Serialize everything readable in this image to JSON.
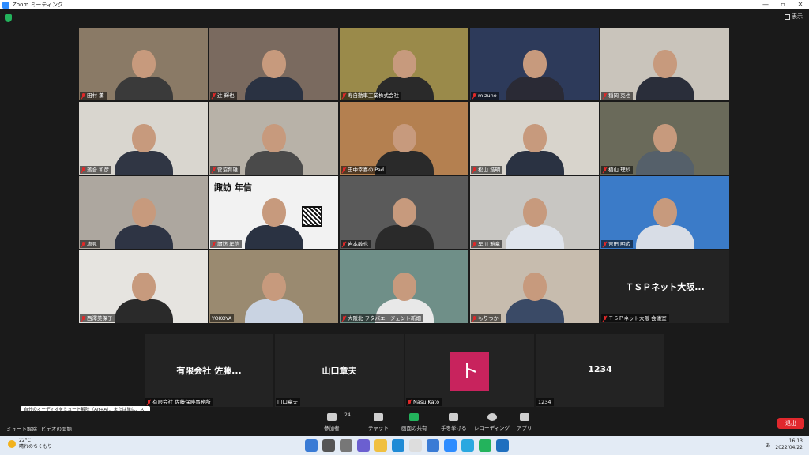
{
  "window": {
    "title": "Zoom ミーティング",
    "controls": [
      "—",
      "▫",
      "✕"
    ]
  },
  "view_label": "表示",
  "tiles": [
    {
      "name": "田村 薫",
      "bg": "#8a7a66",
      "shirt": "#3a3a3a"
    },
    {
      "name": "辻 輝也",
      "bg": "#7a6a5f",
      "shirt": "#2a3242"
    },
    {
      "name": "寿自動車工業株式会社",
      "bg": "#9a8a4a",
      "shirt": "#2a2a2a"
    },
    {
      "name": "mizuno",
      "bg": "#2d3a5a",
      "shirt": "#2a2a35"
    },
    {
      "name": "稲岡 克也",
      "bg": "#c9c4bb",
      "shirt": "#2a2e3a"
    },
    {
      "name": "落合 和彦",
      "bg": "#d9d6cf",
      "shirt": "#303644"
    },
    {
      "name": "菅沼育雄",
      "bg": "#b8b2a8",
      "shirt": "#4a4a4a"
    },
    {
      "name": "田中幸喜のiPad",
      "bg": "#b48050",
      "shirt": "#2a2a2a"
    },
    {
      "name": "松山 浩明",
      "bg": "#d8d4cc",
      "shirt": "#2a3242"
    },
    {
      "name": "橋山 理紗",
      "bg": "#6a6a5a",
      "shirt": "#55606a"
    },
    {
      "name": "塩見",
      "bg": "#ada79f",
      "shirt": "#2e3444"
    },
    {
      "name": "諏訪 年信",
      "bg": "#f2f2f2",
      "shirt": "#2a3242",
      "poster": "諏訪 年信"
    },
    {
      "name": "岩本敏也",
      "bg": "#5a5a5a",
      "shirt": "#2a2a2a"
    },
    {
      "name": "早川 雅章",
      "bg": "#c8c6c2",
      "shirt": "#dfe4ec"
    },
    {
      "name": "吉田 明広",
      "bg": "#3b7bc8",
      "shirt": "#d8dde6"
    },
    {
      "name": "西澤美保子",
      "bg": "#e6e4e0",
      "shirt": "#2a2a2a"
    },
    {
      "name": "YOKOYA",
      "bg": "#9a8a70",
      "shirt": "#c9d3e2"
    },
    {
      "name": "大阪北 フタバエージェント新畑",
      "bg": "#6f8f88",
      "shirt": "#e8e8e8"
    },
    {
      "name": "もりつか",
      "bg": "#c7bcae",
      "shirt": "#3a4a66"
    },
    {
      "name": "ＴＳＰネット大阪 会議室",
      "bg": "#232323",
      "big": "ＴＳＰネット大阪..."
    }
  ],
  "bottom_tiles": [
    {
      "big": "有限会社 佐藤...",
      "name": "有限会社 佐藤保険事務所",
      "muted": true
    },
    {
      "big": "山口章夫",
      "name": "山口章夫",
      "muted": false
    },
    {
      "avatar": "ト",
      "name": "Nasu Kato",
      "muted": true
    },
    {
      "big": "1234",
      "name": "1234",
      "muted": false
    }
  ],
  "tooltip": "自分のオーディオをミュート解除（Alt+A）、または単に、スペースバーを長押しして、一時的にミュートを解除します。",
  "toolbar": {
    "unmute": "ミュート解除",
    "video": "ビデオの開始",
    "participants": "参加者",
    "participants_count": "24",
    "chat": "チャット",
    "share": "画面の共有",
    "raise": "手を挙げる",
    "record": "レコーディング",
    "apps": "アプリ",
    "leave": "退出"
  },
  "taskbar": {
    "temp": "22°C",
    "weather": "晴れのちくもり",
    "ime": "あ",
    "time": "16:13",
    "date": "2022/04/22"
  },
  "colors": {
    "accent": "#2d8cff",
    "leave": "#e0282d",
    "share": "#23b35c",
    "active_outline": "#d8e26a"
  }
}
